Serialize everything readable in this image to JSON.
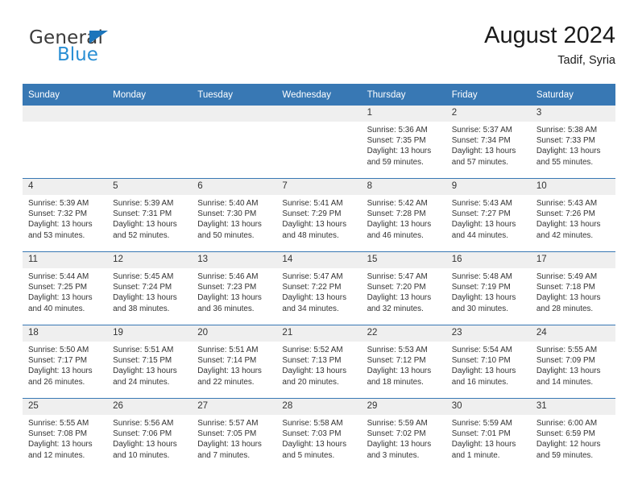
{
  "brand": {
    "name_top": "General",
    "name_bottom": "Blue",
    "triangle_color": "#1b75bb",
    "blue_text_color": "#2a8fd4"
  },
  "header": {
    "title": "August 2024",
    "subtitle": "Tadif, Syria"
  },
  "theme": {
    "header_row_bg": "#3878b4",
    "header_row_text": "#ffffff",
    "daynum_bg": "#efefef",
    "cell_border": "#3878b4",
    "body_text": "#333333"
  },
  "labels": {
    "sunrise_prefix": "Sunrise:",
    "sunset_prefix": "Sunset:",
    "daylight_prefix": "Daylight:"
  },
  "weekdays": [
    "Sunday",
    "Monday",
    "Tuesday",
    "Wednesday",
    "Thursday",
    "Friday",
    "Saturday"
  ],
  "weeks": [
    [
      {
        "day": "",
        "empty": true
      },
      {
        "day": "",
        "empty": true
      },
      {
        "day": "",
        "empty": true
      },
      {
        "day": "",
        "empty": true
      },
      {
        "day": "1",
        "sunrise": "Sunrise: 5:36 AM",
        "sunset": "Sunset: 7:35 PM",
        "daylight": "Daylight: 13 hours and 59 minutes."
      },
      {
        "day": "2",
        "sunrise": "Sunrise: 5:37 AM",
        "sunset": "Sunset: 7:34 PM",
        "daylight": "Daylight: 13 hours and 57 minutes."
      },
      {
        "day": "3",
        "sunrise": "Sunrise: 5:38 AM",
        "sunset": "Sunset: 7:33 PM",
        "daylight": "Daylight: 13 hours and 55 minutes."
      }
    ],
    [
      {
        "day": "4",
        "sunrise": "Sunrise: 5:39 AM",
        "sunset": "Sunset: 7:32 PM",
        "daylight": "Daylight: 13 hours and 53 minutes."
      },
      {
        "day": "5",
        "sunrise": "Sunrise: 5:39 AM",
        "sunset": "Sunset: 7:31 PM",
        "daylight": "Daylight: 13 hours and 52 minutes."
      },
      {
        "day": "6",
        "sunrise": "Sunrise: 5:40 AM",
        "sunset": "Sunset: 7:30 PM",
        "daylight": "Daylight: 13 hours and 50 minutes."
      },
      {
        "day": "7",
        "sunrise": "Sunrise: 5:41 AM",
        "sunset": "Sunset: 7:29 PM",
        "daylight": "Daylight: 13 hours and 48 minutes."
      },
      {
        "day": "8",
        "sunrise": "Sunrise: 5:42 AM",
        "sunset": "Sunset: 7:28 PM",
        "daylight": "Daylight: 13 hours and 46 minutes."
      },
      {
        "day": "9",
        "sunrise": "Sunrise: 5:43 AM",
        "sunset": "Sunset: 7:27 PM",
        "daylight": "Daylight: 13 hours and 44 minutes."
      },
      {
        "day": "10",
        "sunrise": "Sunrise: 5:43 AM",
        "sunset": "Sunset: 7:26 PM",
        "daylight": "Daylight: 13 hours and 42 minutes."
      }
    ],
    [
      {
        "day": "11",
        "sunrise": "Sunrise: 5:44 AM",
        "sunset": "Sunset: 7:25 PM",
        "daylight": "Daylight: 13 hours and 40 minutes."
      },
      {
        "day": "12",
        "sunrise": "Sunrise: 5:45 AM",
        "sunset": "Sunset: 7:24 PM",
        "daylight": "Daylight: 13 hours and 38 minutes."
      },
      {
        "day": "13",
        "sunrise": "Sunrise: 5:46 AM",
        "sunset": "Sunset: 7:23 PM",
        "daylight": "Daylight: 13 hours and 36 minutes."
      },
      {
        "day": "14",
        "sunrise": "Sunrise: 5:47 AM",
        "sunset": "Sunset: 7:22 PM",
        "daylight": "Daylight: 13 hours and 34 minutes."
      },
      {
        "day": "15",
        "sunrise": "Sunrise: 5:47 AM",
        "sunset": "Sunset: 7:20 PM",
        "daylight": "Daylight: 13 hours and 32 minutes."
      },
      {
        "day": "16",
        "sunrise": "Sunrise: 5:48 AM",
        "sunset": "Sunset: 7:19 PM",
        "daylight": "Daylight: 13 hours and 30 minutes."
      },
      {
        "day": "17",
        "sunrise": "Sunrise: 5:49 AM",
        "sunset": "Sunset: 7:18 PM",
        "daylight": "Daylight: 13 hours and 28 minutes."
      }
    ],
    [
      {
        "day": "18",
        "sunrise": "Sunrise: 5:50 AM",
        "sunset": "Sunset: 7:17 PM",
        "daylight": "Daylight: 13 hours and 26 minutes."
      },
      {
        "day": "19",
        "sunrise": "Sunrise: 5:51 AM",
        "sunset": "Sunset: 7:15 PM",
        "daylight": "Daylight: 13 hours and 24 minutes."
      },
      {
        "day": "20",
        "sunrise": "Sunrise: 5:51 AM",
        "sunset": "Sunset: 7:14 PM",
        "daylight": "Daylight: 13 hours and 22 minutes."
      },
      {
        "day": "21",
        "sunrise": "Sunrise: 5:52 AM",
        "sunset": "Sunset: 7:13 PM",
        "daylight": "Daylight: 13 hours and 20 minutes."
      },
      {
        "day": "22",
        "sunrise": "Sunrise: 5:53 AM",
        "sunset": "Sunset: 7:12 PM",
        "daylight": "Daylight: 13 hours and 18 minutes."
      },
      {
        "day": "23",
        "sunrise": "Sunrise: 5:54 AM",
        "sunset": "Sunset: 7:10 PM",
        "daylight": "Daylight: 13 hours and 16 minutes."
      },
      {
        "day": "24",
        "sunrise": "Sunrise: 5:55 AM",
        "sunset": "Sunset: 7:09 PM",
        "daylight": "Daylight: 13 hours and 14 minutes."
      }
    ],
    [
      {
        "day": "25",
        "sunrise": "Sunrise: 5:55 AM",
        "sunset": "Sunset: 7:08 PM",
        "daylight": "Daylight: 13 hours and 12 minutes."
      },
      {
        "day": "26",
        "sunrise": "Sunrise: 5:56 AM",
        "sunset": "Sunset: 7:06 PM",
        "daylight": "Daylight: 13 hours and 10 minutes."
      },
      {
        "day": "27",
        "sunrise": "Sunrise: 5:57 AM",
        "sunset": "Sunset: 7:05 PM",
        "daylight": "Daylight: 13 hours and 7 minutes."
      },
      {
        "day": "28",
        "sunrise": "Sunrise: 5:58 AM",
        "sunset": "Sunset: 7:03 PM",
        "daylight": "Daylight: 13 hours and 5 minutes."
      },
      {
        "day": "29",
        "sunrise": "Sunrise: 5:59 AM",
        "sunset": "Sunset: 7:02 PM",
        "daylight": "Daylight: 13 hours and 3 minutes."
      },
      {
        "day": "30",
        "sunrise": "Sunrise: 5:59 AM",
        "sunset": "Sunset: 7:01 PM",
        "daylight": "Daylight: 13 hours and 1 minute."
      },
      {
        "day": "31",
        "sunrise": "Sunrise: 6:00 AM",
        "sunset": "Sunset: 6:59 PM",
        "daylight": "Daylight: 12 hours and 59 minutes."
      }
    ]
  ]
}
